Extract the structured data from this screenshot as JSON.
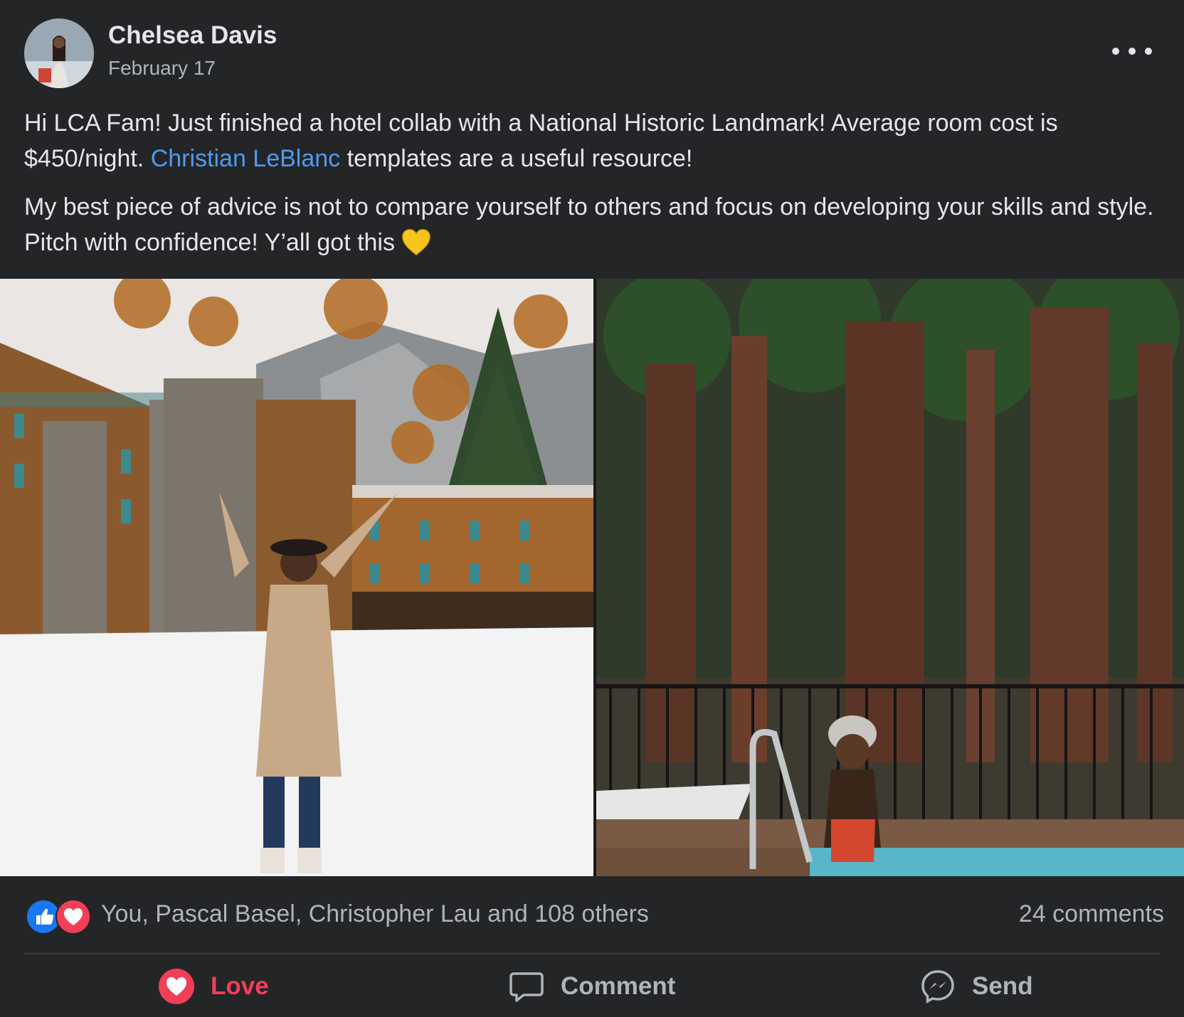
{
  "post": {
    "author": "Chelsea Davis",
    "date": "February 17",
    "paragraph1": {
      "before": "Hi LCA Fam! Just finished a hotel collab with a National Historic Landmark! Average room cost is $450/night. ",
      "mention": "Christian LeBlanc",
      "after": " templates are a useful resource!"
    },
    "paragraph2": "My best piece of advice is not to compare yourself to others and focus on developing your skills and style. Pitch with confidence! Y’all got this",
    "emoji": "yellow-heart-icon"
  },
  "reactions": {
    "icons": [
      "like-icon",
      "love-icon"
    ],
    "summary": "You, Pascal Basel, Christopher Lau and 108 others",
    "comments": "24 comments"
  },
  "actions": {
    "love_label": "Love",
    "comment_label": "Comment",
    "send_label": "Send"
  },
  "colors": {
    "background": "#242526",
    "text": "#e4e6eb",
    "secondary": "#b0b3b8",
    "link": "#4f9bf0",
    "love": "#f33e58",
    "like": "#1877f2"
  }
}
